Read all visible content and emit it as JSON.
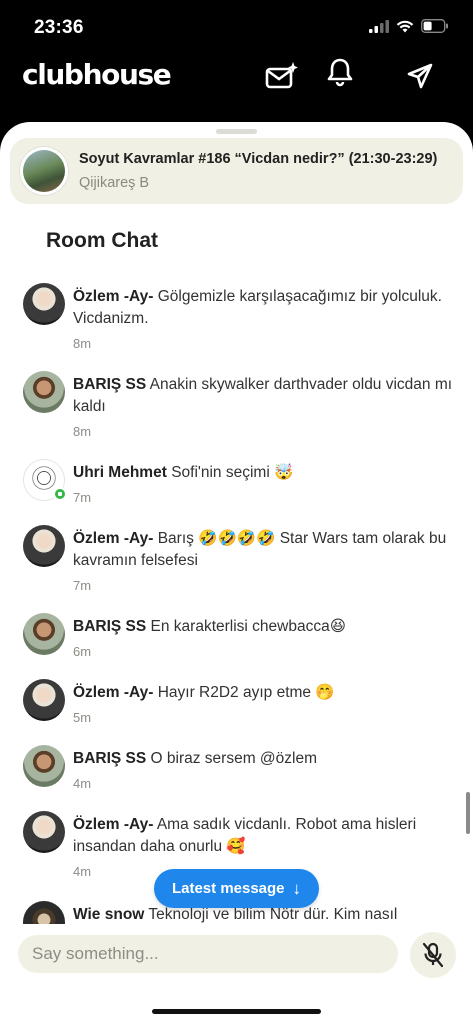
{
  "status_bar": {
    "time": "23:36",
    "icons": [
      "signal-icon",
      "wifi-icon",
      "battery-icon"
    ]
  },
  "app": {
    "logo": "clubhouse",
    "header_icons": [
      "invite-envelope-icon",
      "bell-icon",
      "send-icon"
    ]
  },
  "room": {
    "title": "Soyut Kavramlar #186 “Vicdan nedir?” (21:30-23:29)",
    "host": "Qijikareş B"
  },
  "chat": {
    "heading": "Room Chat",
    "messages": [
      {
        "name": "Özlem -Ay-",
        "text": "Gölgemizle karşılaşacağımız bir yolculuk. Vicdanizm.",
        "time": "8m",
        "avatar": "ozlem"
      },
      {
        "name": "BARIŞ SS",
        "text": "Anakin skywalker darthvader oldu vicdan mı kaldı",
        "time": "8m",
        "avatar": "baris"
      },
      {
        "name": "Uhri Mehmet",
        "text": "Sofi'nin seçimi 🤯",
        "time": "7m",
        "avatar": "uhri",
        "online": true
      },
      {
        "name": "Özlem -Ay-",
        "text": "Barış 🤣🤣🤣🤣  Star Wars tam olarak bu kavramın felsefesi",
        "time": "7m",
        "avatar": "ozlem"
      },
      {
        "name": "BARIŞ SS",
        "text": "En karakterlisi chewbacca😆",
        "time": "6m",
        "avatar": "baris"
      },
      {
        "name": "Özlem -Ay-",
        "text": "Hayır R2D2 ayıp etme 🤭",
        "time": "5m",
        "avatar": "ozlem"
      },
      {
        "name": "BARIŞ SS",
        "text": "O biraz sersem @özlem",
        "time": "4m",
        "avatar": "baris"
      },
      {
        "name": "Özlem -Ay-",
        "text": "Ama sadık vicdanlı. Robot ama hisleri insandan daha onurlu 🥰",
        "time": "4m",
        "avatar": "ozlem"
      },
      {
        "name": "Wie snow",
        "text": "Teknoloji ve bilim Nötr dür. Kim nasıl",
        "time": "",
        "avatar": "wie"
      }
    ],
    "latest_button": "Latest message",
    "latest_arrow": "↓"
  },
  "composer": {
    "placeholder": "Say something...",
    "mic_icon": "mic-muted-icon"
  },
  "colors": {
    "accent": "#1f87ec",
    "banner_bg": "#f1f0e4",
    "online": "#36b64a"
  }
}
